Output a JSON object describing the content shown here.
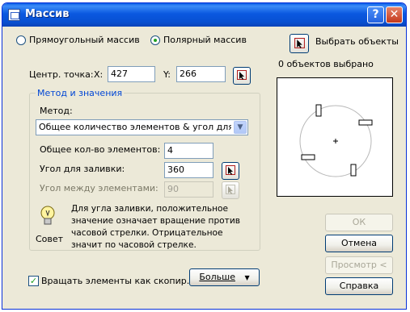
{
  "window": {
    "title": "Массив"
  },
  "mode": {
    "rectangular_label": "Прямоугольный массив",
    "polar_label": "Полярный массив",
    "selected": "polar"
  },
  "center": {
    "label": "Центр. точка:",
    "x_label": "X:",
    "x_value": "427",
    "y_label": "Y:",
    "y_value": "266"
  },
  "method_group": {
    "title": "Метод и значения",
    "method_label": "Метод:",
    "method_value": "Общее количество элементов & угол для заливки",
    "total_items_label": "Общее кол-во элементов:",
    "total_items_value": "4",
    "fill_angle_label": "Угол для заливки:",
    "fill_angle_value": "360",
    "between_angle_label": "Угол между элементами:",
    "between_angle_value": "90",
    "tip_text": "Для угла заливки, положительное значение означает вращение против часовой стрелки.  Отрицательное значит по часовой стрелке.",
    "tip_label": "Совет"
  },
  "rotate": {
    "label": "Вращать элементы как скопир.",
    "checked": true
  },
  "more_button": "Больше",
  "select_objects": {
    "label": "Выбрать объекты",
    "count_text": "0 объектов выбрано"
  },
  "buttons": {
    "ok": "ОК",
    "cancel": "Отмена",
    "preview": "Просмотр <",
    "help": "Справка"
  },
  "icons": {
    "title": "app-icon",
    "help": "help-icon",
    "close": "close-icon",
    "pick": "pick-point-icon",
    "bulb": "lightbulb-icon"
  }
}
